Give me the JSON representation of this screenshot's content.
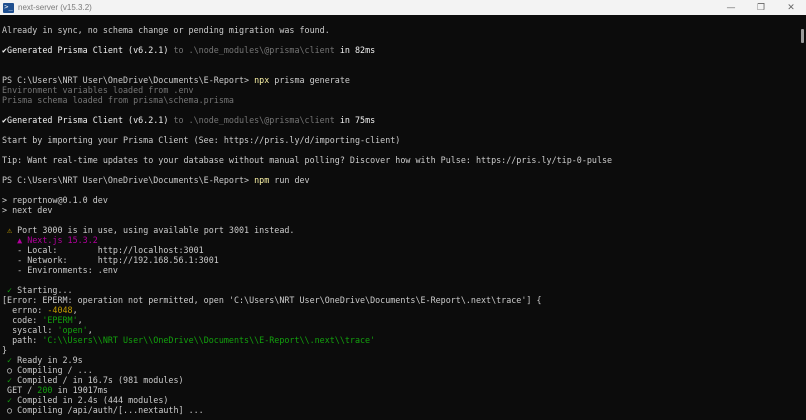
{
  "window": {
    "title": "next-server (v15.3.2)",
    "minimize": "—",
    "maximize": "❐",
    "close": "✕"
  },
  "lines": [
    [
      "Already in sync, no schema change or pending migration was found."
    ],
    [],
    [
      "✔Generated Prisma Client (v6.2.1)",
      " to ",
      ".\\node_modules\\@prisma\\client",
      " in 82ms"
    ],
    [],
    [],
    [
      "PS C:\\Users\\NRT User\\OneDrive\\Documents\\E-Report> ",
      "npx",
      " prisma generate"
    ],
    [
      "Environment variables loaded from .env"
    ],
    [
      "Prisma schema loaded from prisma\\schema.prisma"
    ],
    [],
    [
      "✔Generated Prisma Client (v6.2.1)",
      " to ",
      ".\\node_modules\\@prisma\\client",
      " in 75ms"
    ],
    [],
    [
      "Start by importing your Prisma Client (See: https://pris.ly/d/importing-client)"
    ],
    [],
    [
      "Tip: Want real-time updates to your database without manual polling? Discover how with Pulse: https://pris.ly/tip-0-pulse"
    ],
    [],
    [
      "PS C:\\Users\\NRT User\\OneDrive\\Documents\\E-Report> ",
      "npm",
      " run dev"
    ],
    [],
    [
      "> reportnow@0.1.0 dev"
    ],
    [
      "> next dev"
    ],
    [],
    [
      " ⚠",
      " Port 3000 is in use, using available port 3001 instead."
    ],
    [
      "   ▲ Next.js 15.3.2"
    ],
    [
      "   - Local:        http://localhost:3001"
    ],
    [
      "   - Network:      http://192.168.56.1:3001"
    ],
    [
      "   - Environments: .env"
    ],
    [],
    [
      " ✓",
      " Starting..."
    ],
    [
      "[Error: EPERM: operation not permitted, open 'C:\\Users\\NRT User\\OneDrive\\Documents\\E-Report\\.next\\trace'] {"
    ],
    [
      "  errno: ",
      "-4048",
      ","
    ],
    [
      "  code: ",
      "'EPERM'",
      ","
    ],
    [
      "  syscall: ",
      "'open'",
      ","
    ],
    [
      "  path: ",
      "'C:\\\\Users\\\\NRT User\\\\OneDrive\\\\Documents\\\\E-Report\\\\.next\\\\trace'"
    ],
    [
      "}"
    ],
    [
      " ✓",
      " Ready in 2.9s"
    ],
    [
      " ○",
      " Compiling / ..."
    ],
    [
      " ✓",
      " Compiled / in 16.7s (981 modules)"
    ],
    [
      " GET / ",
      "200",
      " in 19017ms"
    ],
    [
      " ✓",
      " Compiled in 2.4s (444 modules)"
    ],
    [
      " ○",
      " Compiling /api/auth/[...nextauth] ..."
    ]
  ]
}
